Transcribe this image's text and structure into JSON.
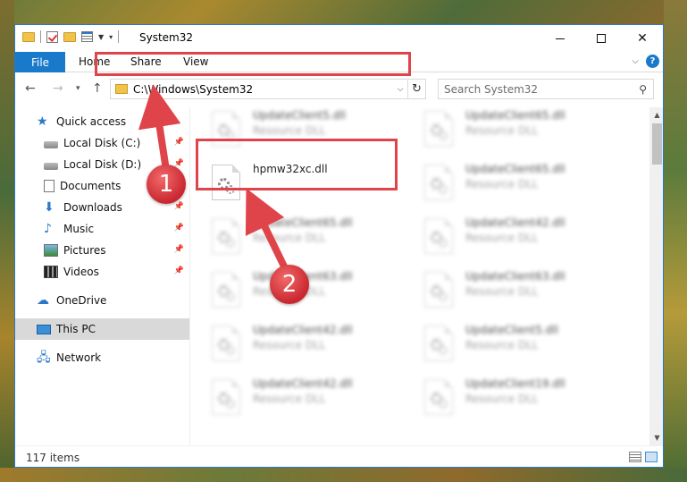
{
  "window": {
    "title": "System32"
  },
  "ribbon": {
    "tabs": [
      "File",
      "Home",
      "Share",
      "View"
    ],
    "help": "?"
  },
  "nav": {
    "address_path": "C:\\Windows\\System32",
    "search_placeholder": "Search System32"
  },
  "sidebar": {
    "items": [
      {
        "label": "Quick access",
        "icon": "quick-access-star-icon"
      },
      {
        "label": "Local Disk (C:)",
        "icon": "disk-icon",
        "pinned": true
      },
      {
        "label": "Local Disk (D:)",
        "icon": "disk-icon",
        "pinned": true
      },
      {
        "label": "Documents",
        "icon": "documents-icon",
        "pinned": true
      },
      {
        "label": "Downloads",
        "icon": "downloads-icon",
        "pinned": true
      },
      {
        "label": "Music",
        "icon": "music-icon",
        "pinned": true
      },
      {
        "label": "Pictures",
        "icon": "pictures-icon",
        "pinned": true
      },
      {
        "label": "Videos",
        "icon": "videos-icon",
        "pinned": true
      },
      {
        "label": "OneDrive",
        "icon": "onedrive-icon"
      },
      {
        "label": "This PC",
        "icon": "this-pc-icon",
        "selected": true
      },
      {
        "label": "Network",
        "icon": "network-icon"
      }
    ]
  },
  "files": [
    {
      "name": "UpdateClient5.dll",
      "type": "Resource DLL",
      "blurred": true
    },
    {
      "name": "UpdateClient65.dll",
      "type": "Resource DLL",
      "blurred": true
    },
    {
      "name": "hpmw32xc.dll",
      "type": "",
      "blurred": false,
      "highlighted": true
    },
    {
      "name": "UpdateClient65.dll",
      "type": "Resource DLL",
      "blurred": true
    },
    {
      "name": "UpdateClient65.dll",
      "type": "Resource DLL",
      "blurred": true
    },
    {
      "name": "UpdateClient42.dll",
      "type": "Resource DLL",
      "blurred": true
    },
    {
      "name": "UpdateClient63.dll",
      "type": "Resource DLL",
      "blurred": true
    },
    {
      "name": "UpdateClient63.dll",
      "type": "Resource DLL",
      "blurred": true
    },
    {
      "name": "UpdateClient42.dll",
      "type": "Resource DLL",
      "blurred": true
    },
    {
      "name": "UpdateClient5.dll",
      "type": "Resource DLL",
      "blurred": true
    },
    {
      "name": "UpdateClient42.dll",
      "type": "Resource DLL",
      "blurred": true
    },
    {
      "name": "UpdateClient19.dll",
      "type": "Resource DLL",
      "blurred": true
    }
  ],
  "status": {
    "item_count": "117 items"
  },
  "annotations": {
    "step1": "1",
    "step2": "2"
  },
  "colors": {
    "accent": "#1979ca",
    "highlight": "#e0444b"
  }
}
